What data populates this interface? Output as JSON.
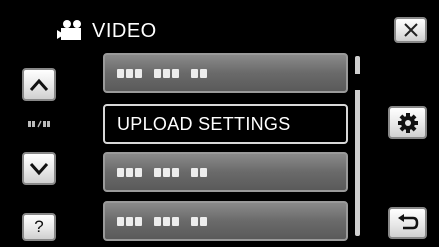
{
  "header": {
    "title": "VIDEO",
    "icon": "video-camera-icon"
  },
  "nav": {
    "up_icon": "chevron-up-icon",
    "down_icon": "chevron-down-icon",
    "help_label": "?",
    "page_indicator": "page-indicator-icon"
  },
  "menu": {
    "items": [
      {
        "label": "",
        "placeholder": true
      },
      {
        "label": "UPLOAD SETTINGS",
        "placeholder": false,
        "selected": true
      },
      {
        "label": "",
        "placeholder": true
      },
      {
        "label": "",
        "placeholder": true
      }
    ]
  },
  "actions": {
    "close_icon": "close-icon",
    "settings_icon": "gear-icon",
    "back_icon": "return-icon"
  },
  "colors": {
    "background": "#000000",
    "button_face": "#e8e8e8",
    "menu_item": "#6e6e6e",
    "selected_border": "#d8d8d8",
    "text": "#ffffff"
  }
}
